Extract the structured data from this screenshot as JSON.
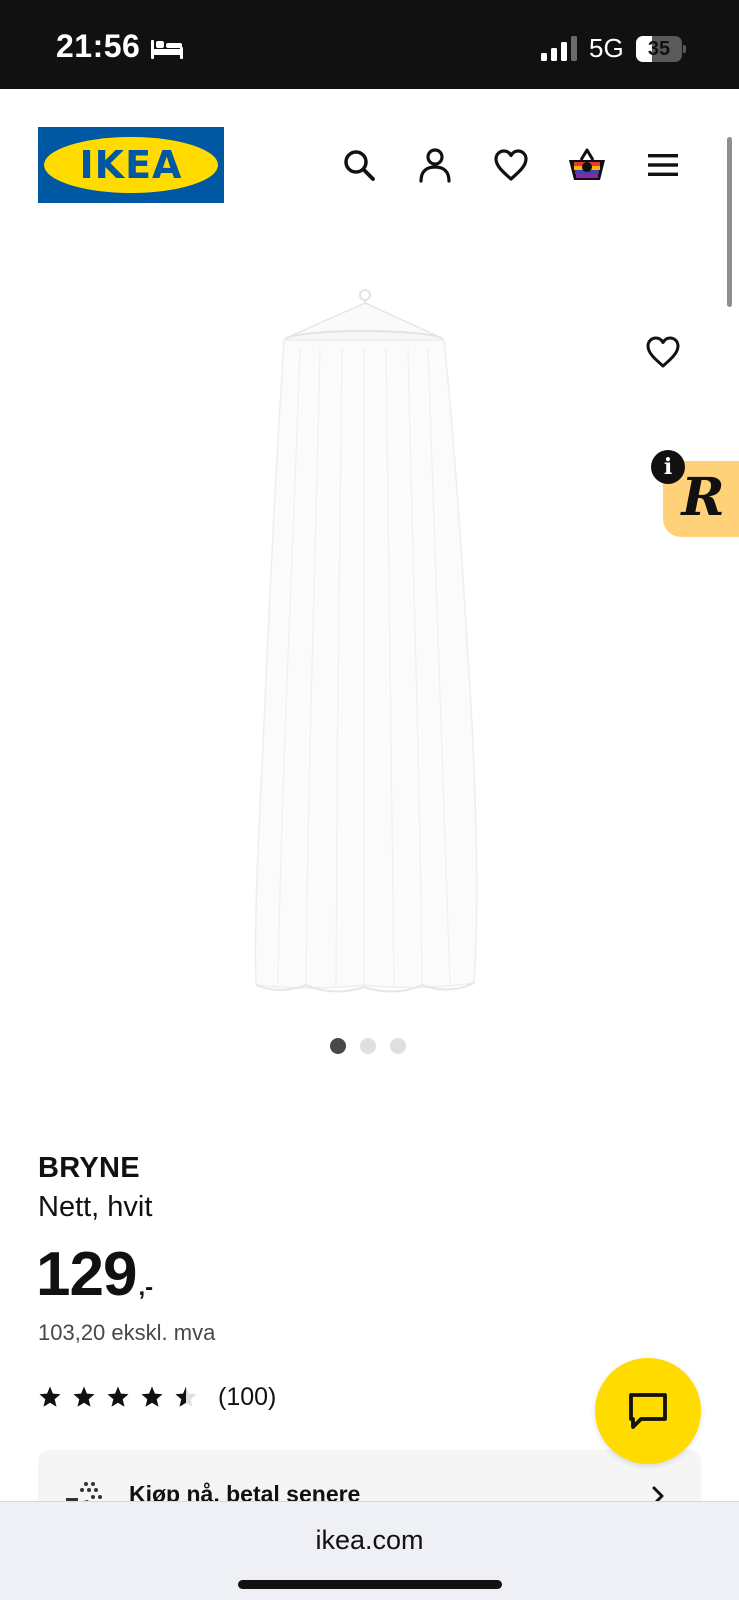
{
  "status_bar": {
    "time": "21:56",
    "network": "5G",
    "battery": "35",
    "battery_level": 0.35,
    "icons": [
      "bed-icon",
      "signal-icon",
      "battery-icon"
    ]
  },
  "header": {
    "logo_text": "IKEA",
    "icons": [
      "search-icon",
      "account-icon",
      "favorites-icon",
      "shopping-bag-icon",
      "menu-icon"
    ]
  },
  "gallery": {
    "image_subject": "white bed canopy net",
    "image_count": 3,
    "active_index": 0,
    "overlay_icons": [
      "favorite-icon",
      "info-icon"
    ],
    "widget_letter": "R"
  },
  "product": {
    "name": "BRYNE",
    "description": "Nett, hvit",
    "price": "129",
    "price_suffix": ",-",
    "price_ex_vat": "103,20 ekskl. mva",
    "rating": 4.5,
    "rating_max": 5,
    "rating_count": "(100)"
  },
  "financing": {
    "label": "Kjøp nå, betal senere"
  },
  "chat": {
    "icon": "chat-icon"
  },
  "browser": {
    "url": "ikea.com"
  },
  "colors": {
    "ikea_blue": "#0058a3",
    "ikea_yellow": "#ffdb00",
    "status_bar": "#111111",
    "widget_bg": "#ffd27a",
    "card_bg": "#f5f5f5"
  }
}
